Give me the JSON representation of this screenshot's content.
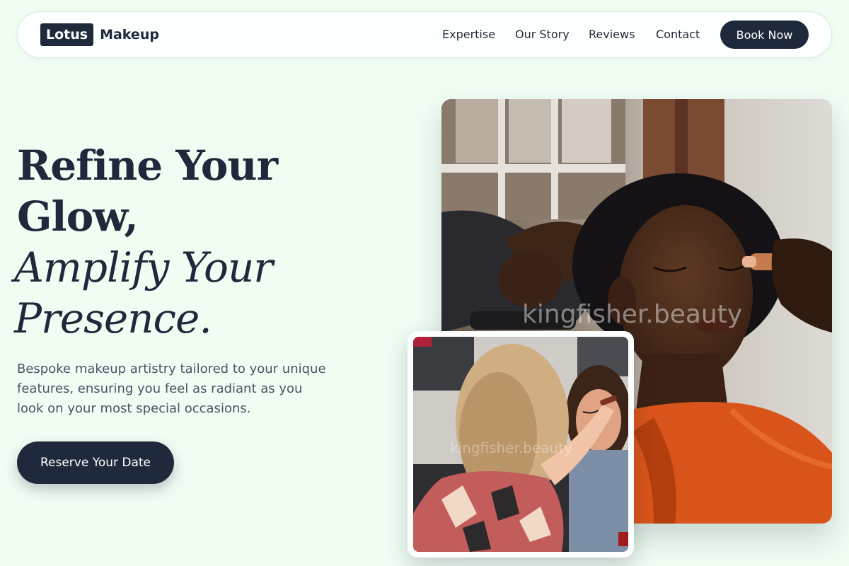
{
  "nav": {
    "logo_box": "Lotus",
    "logo_word": "Makeup",
    "links": [
      "Expertise",
      "Our Story",
      "Reviews",
      "Contact"
    ],
    "cta": "Book Now"
  },
  "hero": {
    "headline_line1": "Refine Your",
    "headline_line2": "Glow,",
    "italic_line1": "Amplify Your",
    "italic_line2": "Presence.",
    "subtitle": "Bespoke makeup artistry tailored to your unique features, ensuring you feel as radiant as you look on your most special occasions.",
    "cta": "Reserve Your Date"
  },
  "images": {
    "watermark": "kingfisher.beauty"
  },
  "colors": {
    "background": "#effdf3",
    "navy": "#1e293b",
    "body_text": "#475569",
    "accent_orange": "#d9541a"
  }
}
